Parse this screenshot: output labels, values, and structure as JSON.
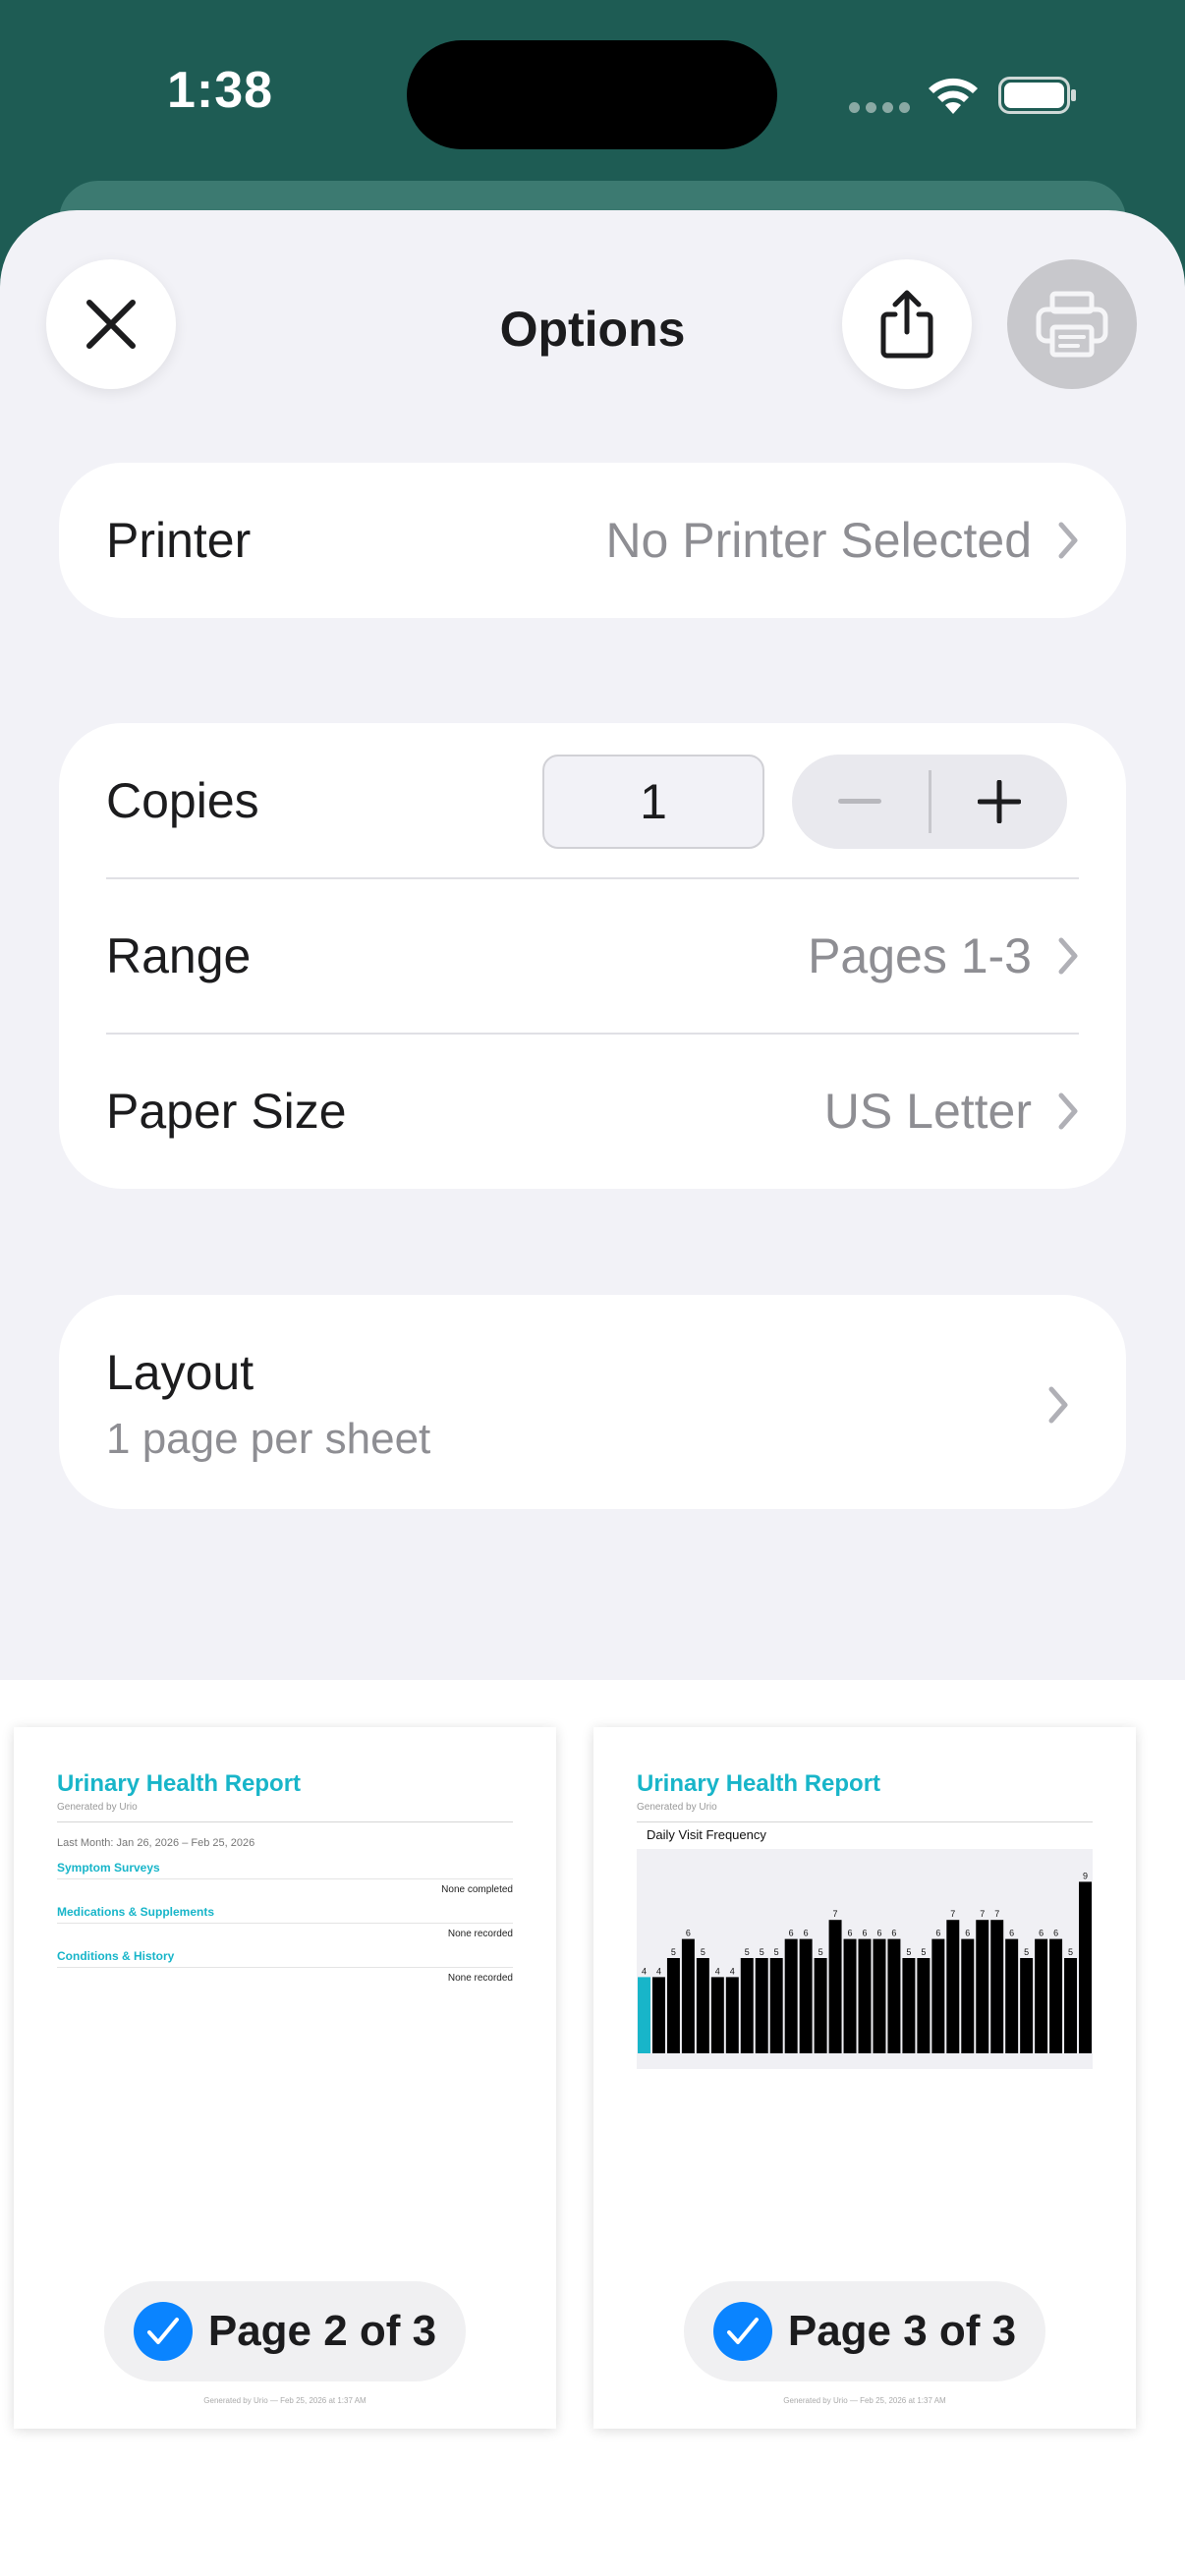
{
  "status_bar": {
    "time": "1:38"
  },
  "sheet": {
    "title": "Options",
    "close_icon": "close-icon",
    "share_icon": "share-icon",
    "print_icon": "printer-icon"
  },
  "printer": {
    "label": "Printer",
    "value": "No Printer Selected"
  },
  "copies": {
    "label": "Copies",
    "value": "1",
    "minus": "−",
    "plus": "+"
  },
  "range": {
    "label": "Range",
    "value": "Pages 1-3"
  },
  "paper": {
    "label": "Paper Size",
    "value": "US Letter"
  },
  "layout": {
    "label": "Layout",
    "sub": "1 page per sheet"
  },
  "colors": {
    "accent": "#18b5c9",
    "check": "#0a84ff",
    "header": "#1e5c54"
  },
  "previews": [
    {
      "title": "Urinary Health Report",
      "generated": "Generated by Urio",
      "date_range": "Last Month: Jan 26, 2026 – Feb 25, 2026",
      "sections": [
        {
          "title": "Symptom Surveys",
          "value": "None completed"
        },
        {
          "title": "Medications & Supplements",
          "value": "None recorded"
        },
        {
          "title": "Conditions & History",
          "value": "None recorded"
        }
      ],
      "footer": "Generated by Urio — Feb 25, 2026 at 1:37 AM",
      "page_label": "Page 2 of 3"
    },
    {
      "title": "Urinary Health Report",
      "generated": "Generated by Urio",
      "chart_title": "Daily Visit Frequency",
      "footer": "Generated by Urio — Feb 25, 2026 at 1:37 AM",
      "page_label": "Page 3 of 3"
    }
  ],
  "chart_data": {
    "type": "bar",
    "title": "Daily Visit Frequency",
    "xlabel": "",
    "ylabel": "",
    "ylim": [
      0,
      10
    ],
    "values": [
      4,
      4,
      5,
      6,
      5,
      4,
      4,
      5,
      5,
      5,
      6,
      6,
      5,
      7,
      6,
      6,
      6,
      6,
      5,
      5,
      6,
      7,
      6,
      7,
      7,
      6,
      5,
      6,
      6,
      5,
      9
    ],
    "highlight_index": 0,
    "highlight_color": "#18b5c9",
    "bar_color": "#000000"
  }
}
